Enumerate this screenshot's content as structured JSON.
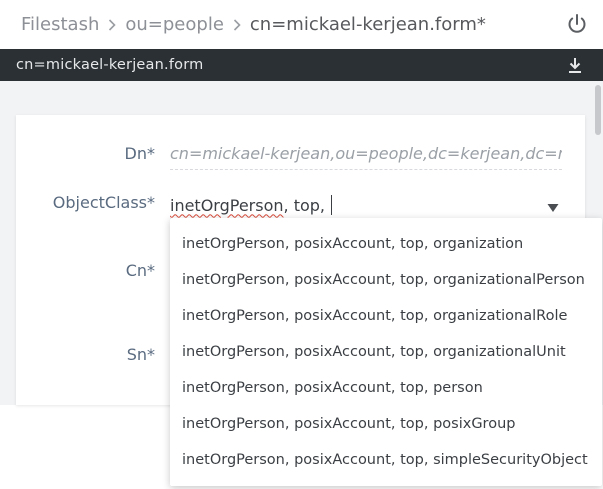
{
  "breadcrumb": {
    "items": [
      "Filestash",
      "ou=people",
      "cn=mickael-kerjean.form*"
    ]
  },
  "icons": {
    "power": "power-icon",
    "download": "download-icon",
    "separator": "chevron-right-icon",
    "dropdown": "caret-down-icon"
  },
  "filebar": {
    "title": "cn=mickael-kerjean.form"
  },
  "form": {
    "dn": {
      "label": "Dn*",
      "value": "cn=mickael-kerjean,ou=people,dc=kerjean,dc=me"
    },
    "objectclass": {
      "label": "ObjectClass*",
      "value_misspelled": "inetOrgPerson",
      "value_rest": ", top, "
    },
    "cn": {
      "label": "Cn*"
    },
    "sn": {
      "label": "Sn*"
    }
  },
  "dropdown": {
    "options": [
      "inetOrgPerson, posixAccount, top, organization",
      "inetOrgPerson, posixAccount, top, organizationalPerson",
      "inetOrgPerson, posixAccount, top, organizationalRole",
      "inetOrgPerson, posixAccount, top, organizationalUnit",
      "inetOrgPerson, posixAccount, top, person",
      "inetOrgPerson, posixAccount, top, posixGroup",
      "inetOrgPerson, posixAccount, top, simpleSecurityObject"
    ]
  },
  "colors": {
    "filebar_bg": "#2b3034",
    "label": "#5a6b80",
    "content_bg": "#f2f3f5",
    "focus_underline": "#cfe3ea"
  }
}
